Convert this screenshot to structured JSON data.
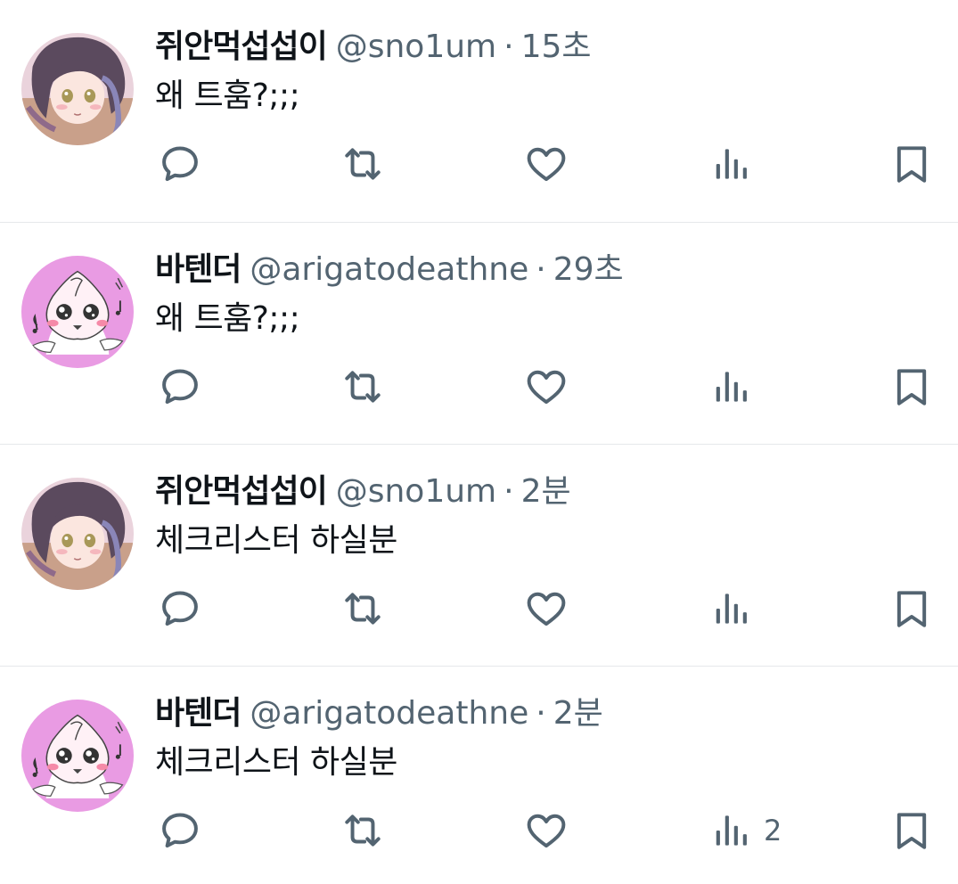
{
  "tweets": [
    {
      "display_name": "쥐안먹섭섭이",
      "handle": "@sno1um",
      "separator": "·",
      "time": "15초",
      "text": "왜 트훔?;;;",
      "views_count": "",
      "avatar": "anime-girl-avatar"
    },
    {
      "display_name": "바텐더",
      "handle": "@arigatodeathne",
      "separator": "·",
      "time": "29초",
      "text": "왜 트훔?;;;",
      "views_count": "",
      "avatar": "pink-peach-character-avatar"
    },
    {
      "display_name": "쥐안먹섭섭이",
      "handle": "@sno1um",
      "separator": "·",
      "time": "2분",
      "text": "체크리스터 하실분",
      "views_count": "",
      "avatar": "anime-girl-avatar"
    },
    {
      "display_name": "바텐더",
      "handle": "@arigatodeathne",
      "separator": "·",
      "time": "2분",
      "text": "체크리스터 하실분",
      "views_count": "2",
      "avatar": "pink-peach-character-avatar"
    }
  ],
  "icons": {
    "reply": "reply-icon",
    "retweet": "retweet-icon",
    "like": "like-icon",
    "views": "views-icon",
    "bookmark": "bookmark-icon"
  },
  "colors": {
    "text": "#0f1419",
    "secondary": "#536471",
    "divider": "#e6e8eb"
  }
}
